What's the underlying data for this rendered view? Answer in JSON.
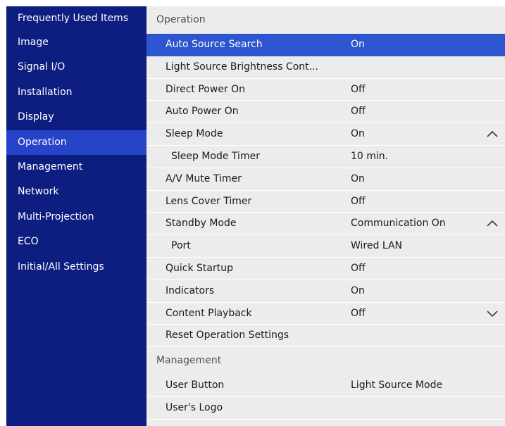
{
  "sidebar": {
    "items": [
      {
        "label": "Frequently Used Items"
      },
      {
        "label": "Image"
      },
      {
        "label": "Signal I/O"
      },
      {
        "label": "Installation"
      },
      {
        "label": "Display"
      },
      {
        "label": "Operation",
        "active": true
      },
      {
        "label": "Management"
      },
      {
        "label": "Network"
      },
      {
        "label": "Multi-Projection"
      },
      {
        "label": "ECO"
      },
      {
        "label": "Initial/All Settings"
      }
    ]
  },
  "main": {
    "operation_header": "Operation",
    "rows": [
      {
        "label": "Auto Source Search",
        "value": "On",
        "selected": true
      },
      {
        "label": "Light Source Brightness Cont...",
        "value": ""
      },
      {
        "label": "Direct Power On",
        "value": "Off"
      },
      {
        "label": "Auto Power On",
        "value": "Off"
      },
      {
        "label": "Sleep Mode",
        "value": "On",
        "chevron": "chevron-up-icon"
      },
      {
        "label": "Sleep Mode Timer",
        "value": "10 min."
      },
      {
        "label": "A/V Mute Timer",
        "value": "On"
      },
      {
        "label": "Lens Cover Timer",
        "value": "Off"
      },
      {
        "label": "Standby Mode",
        "value": "Communication On",
        "chevron": "chevron-up-icon"
      },
      {
        "label": "Port",
        "value": "Wired LAN"
      },
      {
        "label": "Quick Startup",
        "value": "Off"
      },
      {
        "label": "Indicators",
        "value": "On"
      },
      {
        "label": "Content Playback",
        "value": "Off",
        "chevron": "chevron-down-icon"
      },
      {
        "label": "Reset Operation Settings",
        "value": ""
      }
    ],
    "management_header": "Management",
    "management_rows": [
      {
        "label": "User Button",
        "value": "Light Source Mode"
      },
      {
        "label": "User's Logo",
        "value": ""
      }
    ]
  },
  "colors": {
    "sidebar_bg": "#0d1e80",
    "sidebar_active": "#2544c7",
    "row_selected": "#2d55cf",
    "main_bg": "#ececec"
  }
}
